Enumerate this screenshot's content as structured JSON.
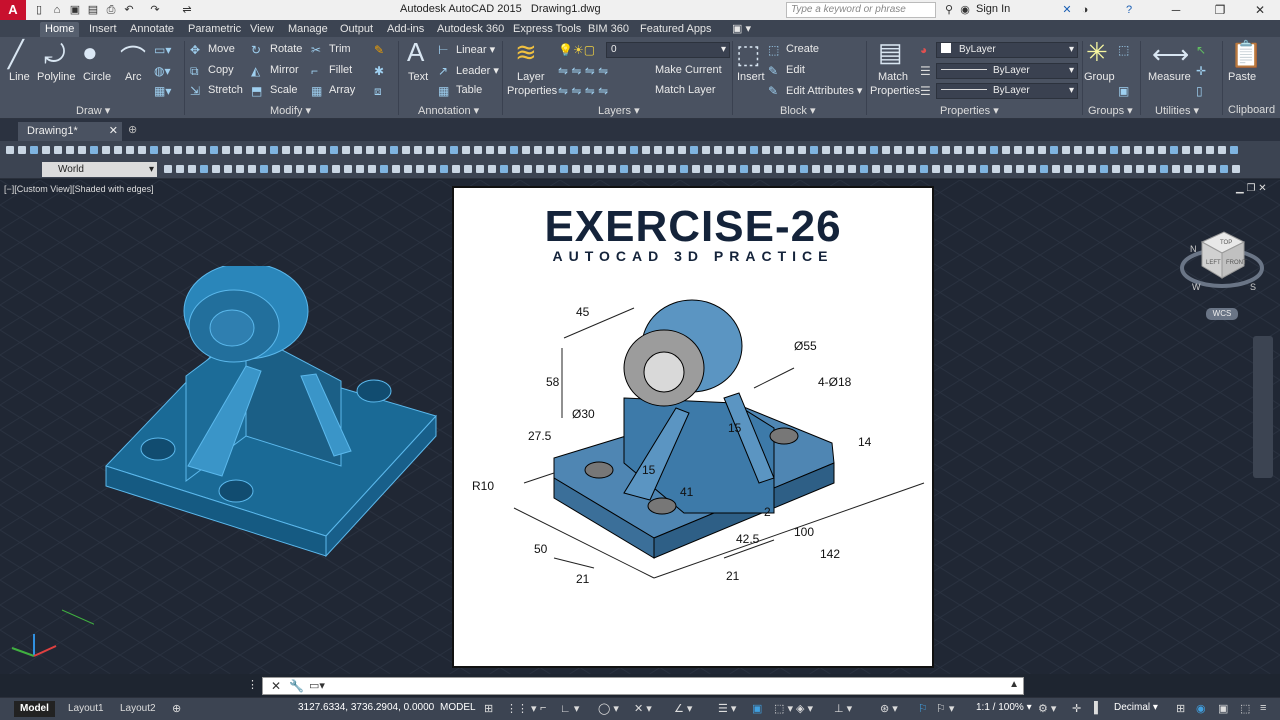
{
  "window": {
    "app_title": "Autodesk AutoCAD 2015",
    "document_title": "Drawing1.dwg",
    "search_placeholder": "Type a keyword or phrase",
    "signin_label": "Sign In"
  },
  "ribbon_tabs": [
    "Home",
    "Insert",
    "Annotate",
    "Parametric",
    "View",
    "Manage",
    "Output",
    "Add-ins",
    "Autodesk 360",
    "Express Tools",
    "BIM 360",
    "Featured Apps"
  ],
  "draw_panel": {
    "line": "Line",
    "polyline": "Polyline",
    "circle": "Circle",
    "arc": "Arc",
    "label": "Draw"
  },
  "modify_panel": {
    "move": "Move",
    "rotate": "Rotate",
    "trim": "Trim",
    "copy": "Copy",
    "mirror": "Mirror",
    "fillet": "Fillet",
    "stretch": "Stretch",
    "scale": "Scale",
    "array": "Array",
    "label": "Modify"
  },
  "annotation_panel": {
    "text": "Text",
    "linear": "Linear",
    "leader": "Leader",
    "table": "Table",
    "label": "Annotation"
  },
  "layers_panel": {
    "layer_properties_1": "Layer",
    "layer_properties_2": "Properties",
    "current_layer": "0",
    "make_current": "Make Current",
    "match_layer": "Match Layer",
    "label": "Layers"
  },
  "block_panel": {
    "insert": "Insert",
    "create": "Create",
    "edit": "Edit",
    "edit_attributes": "Edit Attributes",
    "label": "Block"
  },
  "properties_panel": {
    "match_1": "Match",
    "match_2": "Properties",
    "color": "ByLayer",
    "linetype": "ByLayer",
    "lineweight": "ByLayer",
    "label": "Properties"
  },
  "groups_panel": {
    "group": "Group",
    "label": "Groups"
  },
  "utilities_panel": {
    "measure": "Measure",
    "label": "Utilities"
  },
  "clipboard_panel": {
    "paste": "Paste",
    "label": "Clipboard"
  },
  "doc_tab": "Drawing1*",
  "ucs_combo": "World",
  "viewport_label": "[−][Custom View][Shaded with edges]",
  "viewcube": {
    "top": "TOP",
    "left": "LEFT",
    "front": "FRONT",
    "n": "N",
    "w": "W",
    "s": "S",
    "wcs": "WCS"
  },
  "exercise": {
    "title": "EXERCISE-26",
    "subtitle": "AUTOCAD 3D PRACTICE",
    "dims": [
      "45",
      "Ø55",
      "58",
      "4-Ø18",
      "Ø30",
      "27.5",
      "15",
      "14",
      "R10",
      "15",
      "41",
      "2",
      "42.5",
      "100",
      "50",
      "21",
      "21",
      "142"
    ]
  },
  "status": {
    "coords": "3127.6334, 3736.2904, 0.0000",
    "space": "MODEL",
    "scale": "1:1 / 100%",
    "units": "Decimal",
    "layout_tabs": [
      "Model",
      "Layout1",
      "Layout2"
    ]
  },
  "colors": {
    "accent": "#2e8bc0",
    "ribbon": "#4a5261",
    "viewport": "#202734"
  }
}
